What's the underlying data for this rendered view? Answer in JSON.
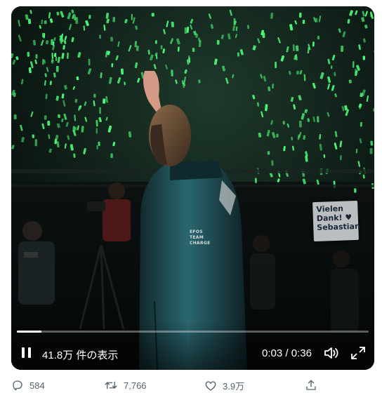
{
  "video": {
    "views_count": "41.8万",
    "views_suffix": "件の表示",
    "current_time": "0:03",
    "duration": "0:36",
    "time_separator": " / ",
    "progress_fraction": 0.07,
    "sign_lines": [
      "Vielen",
      "Dank! ♥",
      "Sebastian"
    ],
    "jacket_text": [
      "EFOS",
      "TEAM",
      "CHARGE"
    ]
  },
  "actions": {
    "reply_count": "584",
    "retweet_count": "7,766",
    "like_count": "3.9万"
  },
  "colors": {
    "glowstick": "#4cff7a",
    "action_icon": "#536471",
    "jacket": "#1f4e56"
  },
  "icons": {
    "reply": "reply-icon",
    "retweet": "retweet-icon",
    "like": "heart-icon",
    "share": "share-icon",
    "pause": "pause-icon",
    "volume": "volume-icon",
    "fullscreen": "fullscreen-icon"
  }
}
